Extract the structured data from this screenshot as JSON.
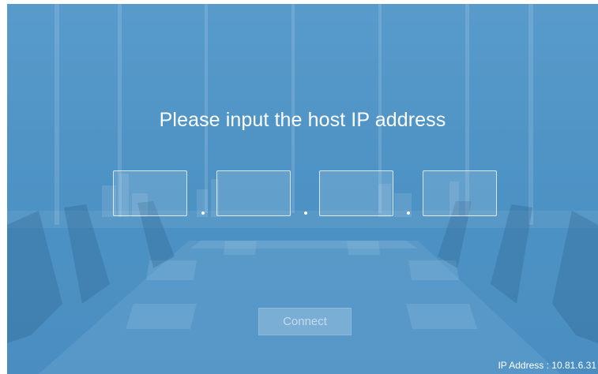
{
  "prompt": {
    "title": "Please input the host IP address"
  },
  "ip_fields": [
    {
      "value": ""
    },
    {
      "value": ""
    },
    {
      "value": ""
    },
    {
      "value": ""
    }
  ],
  "separator": ".",
  "connect_button": {
    "label": "Connect",
    "enabled": false
  },
  "status": {
    "ip_address": "IP Address : 10.81.6.31"
  },
  "colors": {
    "background": "#4f93c4",
    "text": "#ffffff",
    "button_disabled_text": "#a8c9e2"
  }
}
